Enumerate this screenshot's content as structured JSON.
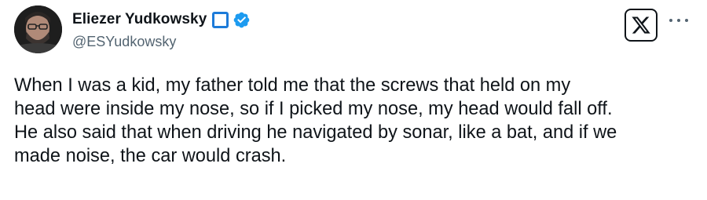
{
  "author": {
    "display_name": "Eliezer Yudkowsky",
    "handle": "@ESYudkowsky"
  },
  "icons": {
    "avatar": "profile-photo",
    "square_badge": "square-badge-icon",
    "verified": "verified-checkmark-icon",
    "x_logo": "x-logo-icon",
    "more": "more-options-icon"
  },
  "colors": {
    "verified_blue": "#1d9bf0",
    "square_badge_blue": "#1d7bd9",
    "handle_gray": "#536471",
    "text": "#0f1419"
  },
  "tweet": {
    "lines": [
      "When I was a kid, my father told me that the screws that held on my",
      "head were inside my nose, so if I picked my nose, my head would fall off.",
      "He also said that when driving he navigated by sonar, like a bat, and if we",
      "made noise, the car would crash."
    ]
  }
}
